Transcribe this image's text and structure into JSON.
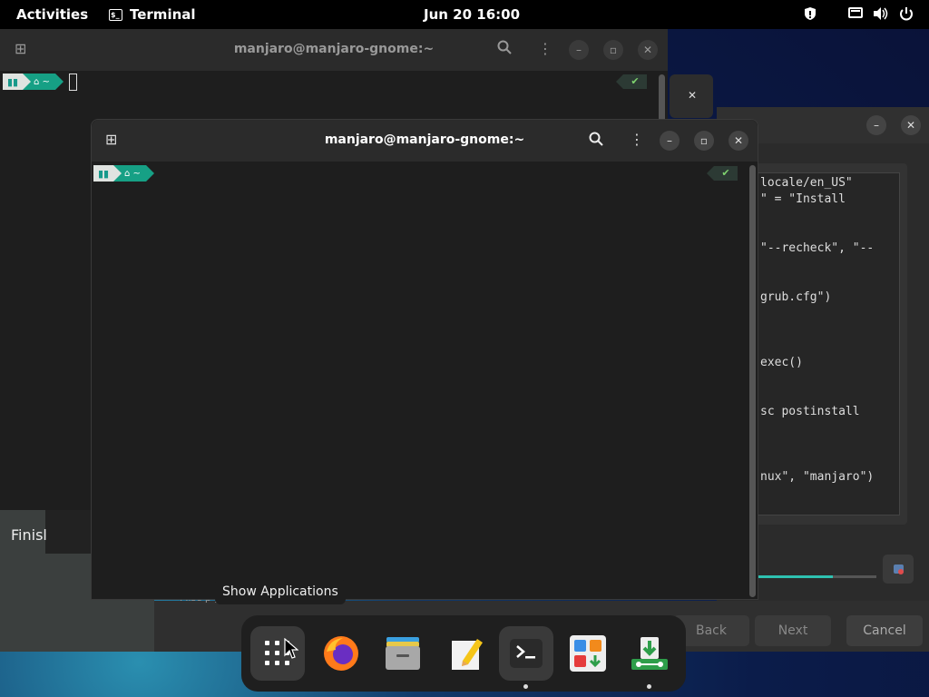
{
  "topbar": {
    "activities": "Activities",
    "app_name": "Terminal",
    "clock": "Jun 20  16:00",
    "tray_icons": [
      "shield-icon",
      "display-icon",
      "volume-icon",
      "power-icon"
    ]
  },
  "term_back": {
    "title": "manjaro@manjaro-gnome:~",
    "prompt_home": "~"
  },
  "term_front": {
    "title": "manjaro@manjaro-gnome:~",
    "prompt_home": "~"
  },
  "installer": {
    "code_lines": [
      "locale/en_US\"",
      "\" = \"Install",
      "\"--recheck\", \"--",
      "grub.cfg\")",
      "exec()",
      "sc postinstall",
      "nux\", \"manjaro\")"
    ],
    "back_label": "Back",
    "next_label": "Next",
    "cancel_label": "Cancel",
    "finish_label": "Finisl",
    "misc_text": "Misc p                     y",
    "progress": 0.63
  },
  "dock": {
    "tooltip": "Show Applications",
    "items": [
      "show-applications",
      "firefox",
      "files",
      "text-editor",
      "terminal",
      "software",
      "installer"
    ]
  },
  "colors": {
    "accent": "#16a085",
    "progress": "#2ec2b1"
  }
}
